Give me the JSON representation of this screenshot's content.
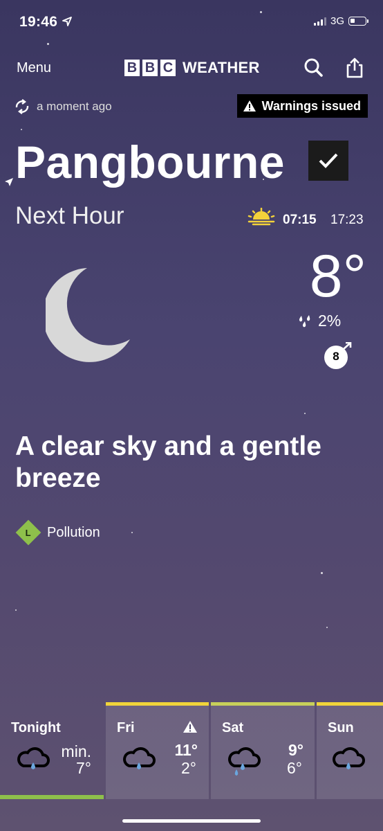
{
  "status_bar": {
    "time": "19:46",
    "network": "3G"
  },
  "header": {
    "menu_label": "Menu",
    "brand_letters": [
      "B",
      "B",
      "C"
    ],
    "brand_word": "WEATHER"
  },
  "update": {
    "text": "a moment ago",
    "warning_label": "Warnings issued"
  },
  "location": {
    "name": "Pangbourne"
  },
  "now": {
    "heading": "Next Hour",
    "sunrise": "07:15",
    "sunset": "17:23",
    "temperature": "8°",
    "rain_chance": "2%",
    "wind_speed": "8",
    "summary": "A clear sky and a gentle breeze",
    "pollution_level": "L",
    "pollution_label": "Pollution"
  },
  "forecast": [
    {
      "day": "Tonight",
      "line1": "min.",
      "line2": "7°",
      "accent": "#8ec04b",
      "icon": "rain-cloud-icon"
    },
    {
      "day": "Fri",
      "line1": "11°",
      "line2": "2°",
      "accent": "#f0d43a",
      "icon": "rain-cloud-icon",
      "warning": true
    },
    {
      "day": "Sat",
      "line1": "9°",
      "line2": "6°",
      "accent": "#c7cf5a",
      "icon": "heavy-rain-cloud-icon"
    },
    {
      "day": "Sun",
      "line1": "",
      "line2": "",
      "accent": "#f0d43a",
      "icon": "rain-cloud-icon"
    }
  ],
  "colors": {
    "warning_bg": "#000000",
    "pollution_low": "#8ec04b",
    "sun_icon": "#f3d23a"
  }
}
